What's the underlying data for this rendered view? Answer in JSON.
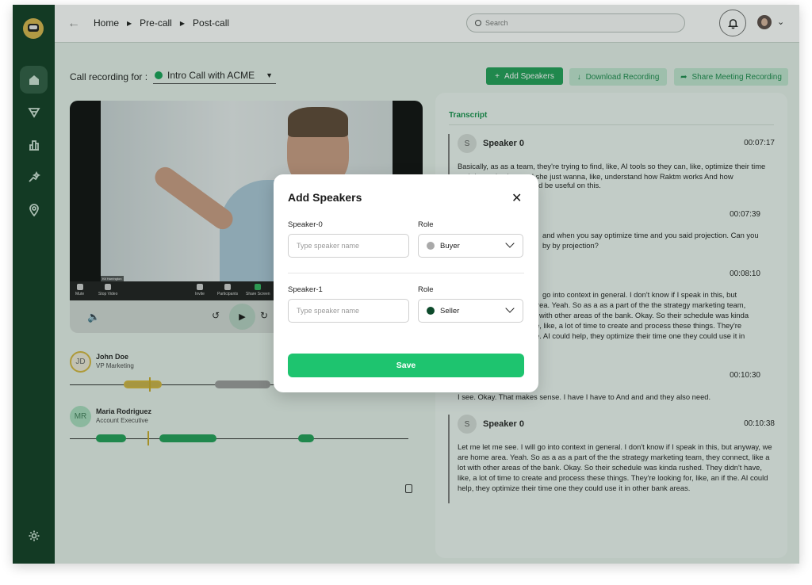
{
  "nav": {
    "back_icon": "arrow-left-icon",
    "breadcrumbs": [
      "Home",
      "Pre-call",
      "Post-call"
    ]
  },
  "search": {
    "placeholder": "Search"
  },
  "sidebar": {
    "items": [
      "home-icon",
      "funnel-icon",
      "chart-icon",
      "sparkle-icon",
      "pin-icon"
    ],
    "bottom": "gear-icon"
  },
  "recording": {
    "label": "Call recording for :",
    "selected": "Intro Call with ACME"
  },
  "actions": {
    "add_speakers": "Add Speakers",
    "download": "Download Recording",
    "share": "Share Meeting Recording"
  },
  "video": {
    "name_tag": "Kit Harrington",
    "toolbar": [
      "Mute",
      "Stop Video",
      "Invite",
      "Participants",
      "Share Screen"
    ]
  },
  "speakers_timeline": [
    {
      "initials": "JD",
      "name": "John Doe",
      "role": "VP Marketing"
    },
    {
      "initials": "MR",
      "name": "Maria Rodriguez",
      "role": "Account Executive"
    }
  ],
  "transcript": {
    "tab": "Transcript",
    "entries": [
      {
        "avatar": "S",
        "speaker": "Speaker 0",
        "time": "00:07:17",
        "text": "Basically, as as a team, they're trying to find, like, AI tools so they can, like, optimize their time and do production, and she just wanna, like, understand how Raktm works And how"
      },
      {
        "time": "00:07:39"
      },
      {
        "time": "00:08:10"
      },
      {
        "time": "00:10:30"
      },
      {
        "avatar": "S",
        "speaker": "Speaker 0",
        "time": "00:10:38",
        "text": "Let me let me see. I will go into context in general. I don't know if I speak in this, but anyway, we are home area. Yeah. So as a as a part of the the strategy marketing team, they connect, like a lot with other areas of the bank. Okay. So their schedule was kinda rushed. They didn't have, like, a lot of time to create and process these things. They're looking for, like, an if the. AI could help, they optimize their time one they could use it in other bank areas."
      }
    ],
    "fragments": {
      "f1": "ld be useful on this.",
      "f2": "and when you say optimize time and you said projection. Can you",
      "f3": "by by projection?",
      "f4": "go into context in general. I don't know if I speak in this, but",
      "f5": "rea. Yeah. So as a as a part of the the strategy marketing team,",
      "f6": "with other areas of the bank. Okay. So their schedule was kinda",
      "f7": "e, like, a lot of time to create and process these things. They're",
      "f8": "e. AI could help, they optimize their time one they could use it in",
      "f9": "I see. Okay. That makes sense. I have I have to And and and they also need."
    }
  },
  "modal": {
    "title": "Add Speakers",
    "rows": [
      {
        "label": "Speaker-0",
        "role_label": "Role",
        "placeholder": "Type speaker name",
        "role": "Buyer",
        "role_color": "#a9a9a9"
      },
      {
        "label": "Speaker-1",
        "role_label": "Role",
        "placeholder": "Type speaker name",
        "role": "Seller",
        "role_color": "#0d4a2b"
      }
    ],
    "save": "Save"
  },
  "colors": {
    "brand": "#0e3a21",
    "accent": "#1ec46f",
    "track_green": "#1e9e55",
    "track_yellow": "#c8a825"
  }
}
